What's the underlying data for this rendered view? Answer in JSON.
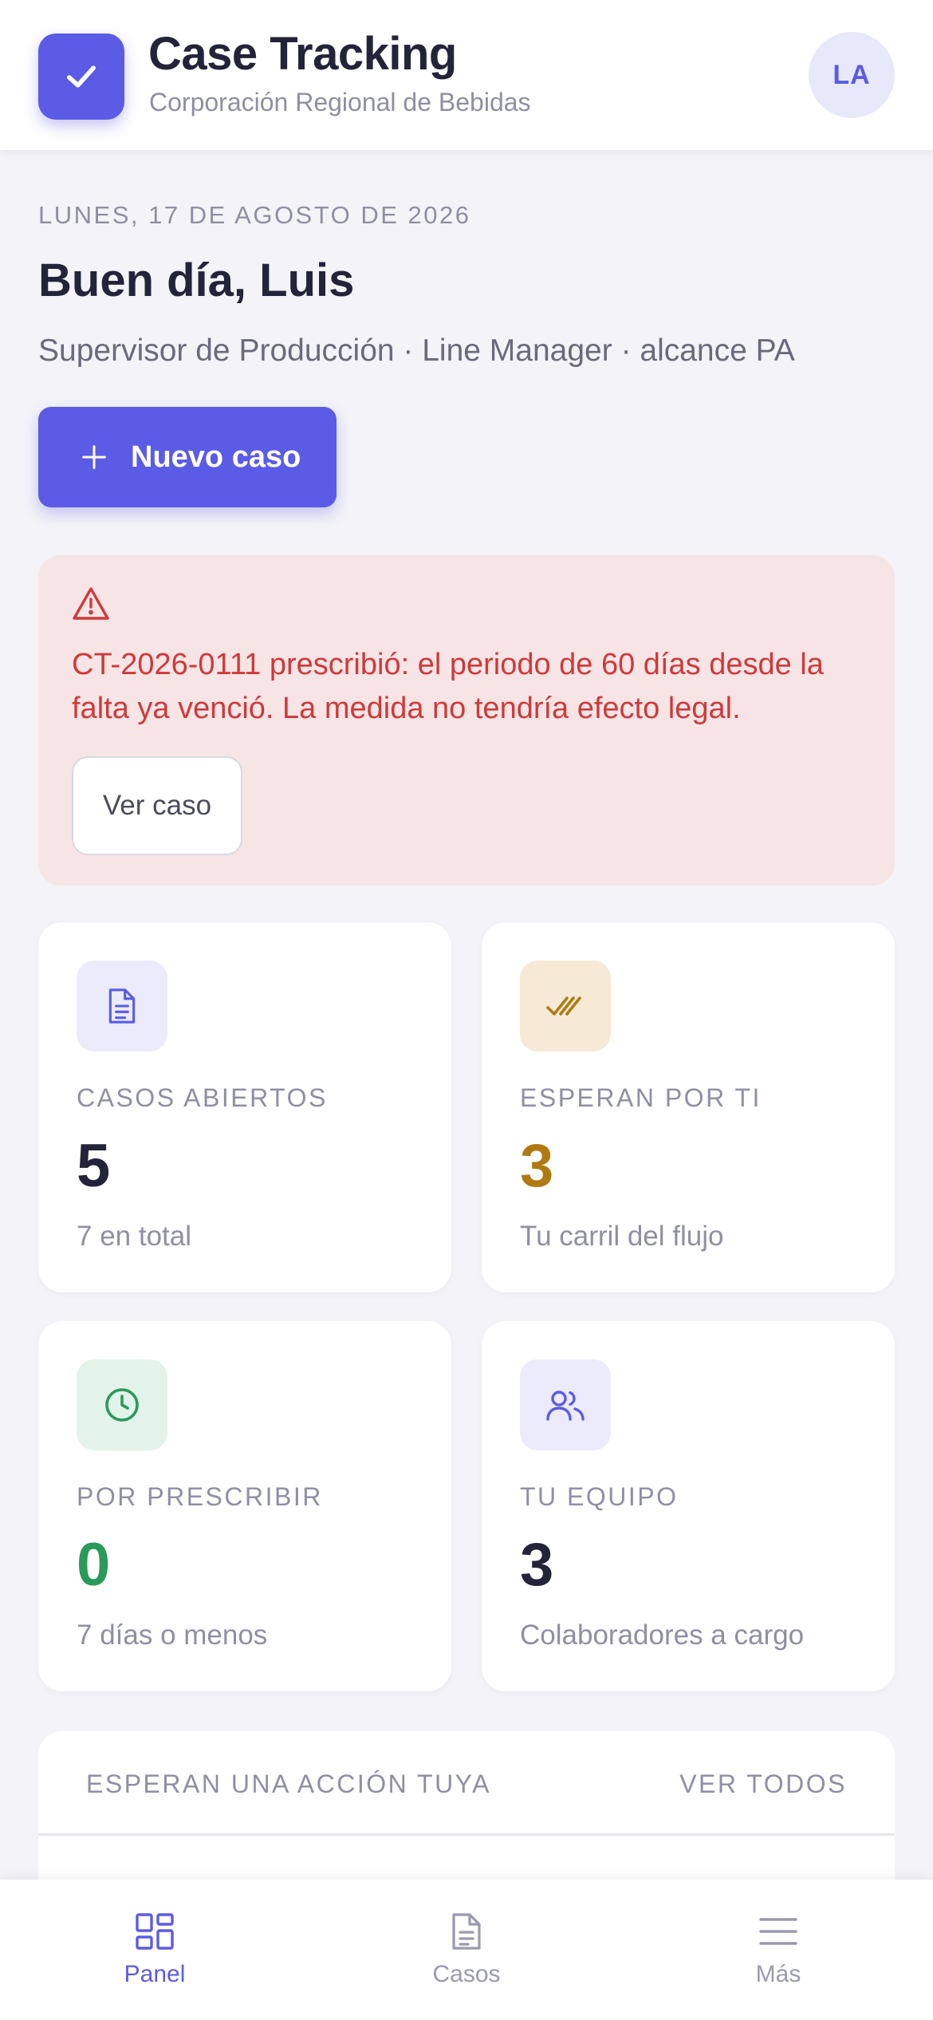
{
  "header": {
    "title": "Case Tracking",
    "subtitle": "Corporación Regional de Bebidas",
    "avatar_initials": "LA"
  },
  "greeting": {
    "date": "LUNES, 17 DE AGOSTO DE 2026",
    "hello": "Buen día, Luis",
    "role": "Supervisor de Producción · Line Manager · alcance PA"
  },
  "new_case_button": {
    "label": "Nuevo caso"
  },
  "alert": {
    "message": "CT-2026-0111 prescribió: el periodo de 60 días desde la falta ya venció. La medida no tendría efecto legal.",
    "button_label": "Ver caso"
  },
  "stats": [
    {
      "label": "CASOS ABIERTOS",
      "value": "5",
      "sub": "7 en total",
      "icon": "document-icon",
      "value_color": "#23233a",
      "icon_bg": "#ebebfb",
      "icon_color": "#5b5be6"
    },
    {
      "label": "ESPERAN POR TI",
      "value": "3",
      "sub": "Tu carril del flujo",
      "icon": "double-check-icon",
      "value_color": "#b07a12",
      "icon_bg": "#f6ead7",
      "icon_color": "#b07a12"
    },
    {
      "label": "POR PRESCRIBIR",
      "value": "0",
      "sub": "7 días o menos",
      "icon": "clock-icon",
      "value_color": "#2a9a5a",
      "icon_bg": "#e3f3ea",
      "icon_color": "#2a9a5a"
    },
    {
      "label": "TU EQUIPO",
      "value": "3",
      "sub": "Colaboradores a cargo",
      "icon": "users-icon",
      "value_color": "#23233a",
      "icon_bg": "#ebebfb",
      "icon_color": "#5b5be6"
    }
  ],
  "action_panel": {
    "title": "ESPERAN UNA ACCIÓN TUYA",
    "link": "VER TODOS"
  },
  "bottom_nav": [
    {
      "label": "Panel",
      "icon": "dashboard-icon",
      "active": true
    },
    {
      "label": "Casos",
      "icon": "document-icon",
      "active": false
    },
    {
      "label": "Más",
      "icon": "menu-icon",
      "active": false
    }
  ],
  "colors": {
    "accent": "#5b5be6",
    "danger": "#d0393a",
    "nav_inactive": "#9a9aad"
  }
}
